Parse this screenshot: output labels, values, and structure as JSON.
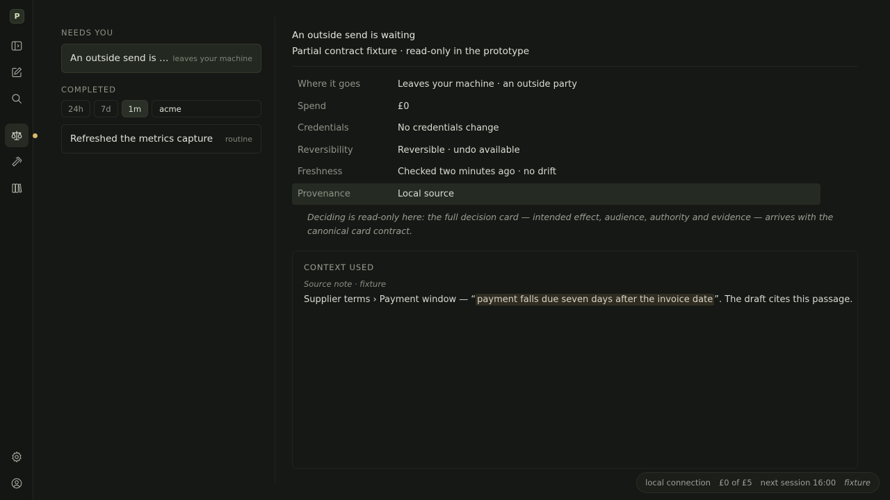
{
  "rail": {
    "logo": "P",
    "items": [
      {
        "icon": "sidebar-toggle-icon"
      },
      {
        "icon": "compose-icon"
      },
      {
        "icon": "search-icon"
      },
      {
        "icon": "scales-icon",
        "active": true
      },
      {
        "icon": "hammer-icon"
      },
      {
        "icon": "library-icon"
      }
    ],
    "bottom": [
      {
        "icon": "gear-icon"
      },
      {
        "icon": "account-icon"
      }
    ]
  },
  "sidebar": {
    "needs_you_label": "NEEDS YOU",
    "needs_you": [
      {
        "title": "An outside send is w...",
        "meta": "leaves your machine"
      }
    ],
    "completed_label": "COMPLETED",
    "filters": [
      "24h",
      "7d",
      "1m"
    ],
    "active_filter": "1m",
    "search_value": "acme",
    "completed": [
      {
        "title": "Refreshed the metrics capture",
        "meta": "routine"
      }
    ]
  },
  "main": {
    "title": "An outside send is waiting",
    "subtitle": "Partial contract fixture · read-only in the prototype",
    "rows": [
      {
        "key": "Where it goes",
        "value": "Leaves your machine · an outside party"
      },
      {
        "key": "Spend",
        "value": "£0"
      },
      {
        "key": "Credentials",
        "value": "No credentials change"
      },
      {
        "key": "Reversibility",
        "value": "Reversible · undo available"
      },
      {
        "key": "Freshness",
        "value": "Checked two minutes ago · no drift"
      },
      {
        "key": "Provenance",
        "value": "Local source"
      }
    ],
    "note": "Deciding is read-only here: the full decision card — intended effect, audience, authority and evidence — arrives with the canonical card contract.",
    "context": {
      "label": "CONTEXT USED",
      "source": "Source note · fixture",
      "prefix": "Supplier terms › Payment window — “",
      "quote": "payment falls due seven days after the invoice date",
      "suffix": "”. The draft cites this passage."
    }
  },
  "status": {
    "connection": "local connection",
    "budget": "£0 of £5",
    "next_session": "next session 16:00",
    "mode": "fixture"
  }
}
